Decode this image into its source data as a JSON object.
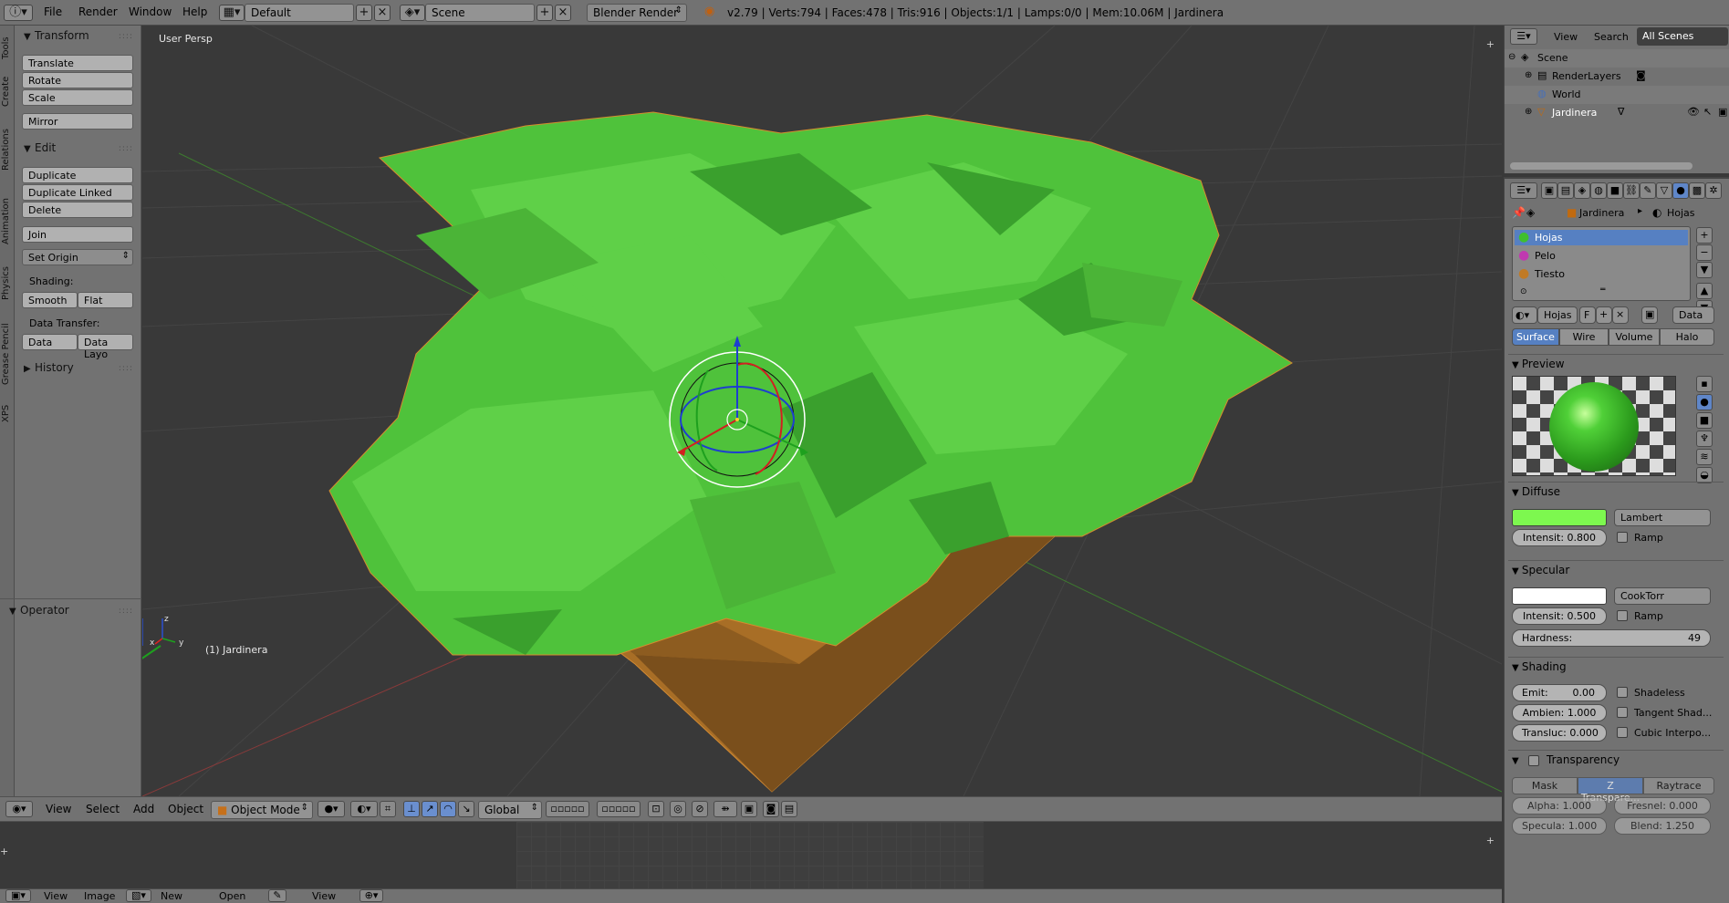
{
  "topbar": {
    "info_icon": "info-icon",
    "menus": [
      "File",
      "Render",
      "Window",
      "Help"
    ],
    "layout": "Default",
    "scene": "Scene",
    "engine": "Blender Render",
    "stats": "v2.79 | Verts:794 | Faces:478 | Tris:916 | Objects:1/1 | Lamps:0/0 | Mem:10.06M | Jardinera"
  },
  "vtabs": [
    "Tools",
    "Create",
    "Relations",
    "Animation",
    "Physics",
    "Grease Pencil",
    "XPS"
  ],
  "toolshelf": {
    "transform": {
      "title": "Transform",
      "buttons": [
        "Translate",
        "Rotate",
        "Scale"
      ],
      "mirror": "Mirror"
    },
    "edit": {
      "title": "Edit",
      "buttons": [
        "Duplicate",
        "Duplicate Linked",
        "Delete"
      ],
      "join": "Join",
      "set_origin": "Set Origin"
    },
    "shading": {
      "label": "Shading:",
      "smooth": "Smooth",
      "flat": "Flat"
    },
    "data_transfer": {
      "label": "Data Transfer:",
      "data": "Data",
      "data_layout": "Data Layo"
    },
    "history": "History",
    "operator": "Operator"
  },
  "viewport": {
    "view_label": "User Persp",
    "object_label": "(1) Jardinera",
    "axis_x": "x",
    "axis_y": "y",
    "axis_z": "z",
    "foliage_color": "#4fc23b",
    "pot_color": "#a86e26",
    "magenta": "#b03cb8"
  },
  "view3d_header": {
    "menus": [
      "View",
      "Select",
      "Add",
      "Object"
    ],
    "mode": "Object Mode",
    "orientation": "Global"
  },
  "bottom_header": {
    "menus": [
      "View",
      "Image"
    ],
    "new": "New",
    "open": "Open",
    "view": "View"
  },
  "outliner": {
    "tabs": [
      "View",
      "Search",
      "All Scenes"
    ],
    "rows": [
      "Scene",
      "RenderLayers",
      "World",
      "Jardinera"
    ]
  },
  "properties": {
    "breadcrumb": [
      "Jardinera",
      "Hojas"
    ],
    "materials": [
      {
        "name": "Hojas",
        "color": "#3fbf2f",
        "selected": true
      },
      {
        "name": "Pelo",
        "color": "#c039b0",
        "selected": false
      },
      {
        "name": "Tiesto",
        "color": "#c07a25",
        "selected": false
      }
    ],
    "material_name": "Hojas",
    "fake_user": "F",
    "data": "Data",
    "type_tabs": [
      "Surface",
      "Wire",
      "Volume",
      "Halo"
    ],
    "preview": "Preview",
    "diffuse": {
      "title": "Diffuse",
      "color": "#7df84f",
      "shader": "Lambert",
      "intensity": "Intensit: 0.800",
      "ramp": "Ramp"
    },
    "specular": {
      "title": "Specular",
      "color": "#ffffff",
      "shader": "CookTorr",
      "intensity": "Intensit: 0.500",
      "ramp": "Ramp",
      "hardness_label": "Hardness:",
      "hardness_value": "49"
    },
    "shading": {
      "title": "Shading",
      "emit": "Emit:",
      "emit_value": "0.00",
      "ambient": "Ambien: 1.000",
      "transluc": "Transluc: 0.000",
      "shadeless": "Shadeless",
      "tangent": "Tangent Shad...",
      "cubic": "Cubic Interpo..."
    },
    "transparency": {
      "title": "Transparency",
      "tabs": [
        "Mask",
        "Z Transpare...",
        "Raytrace"
      ],
      "alpha": "Alpha: 1.000",
      "fresnel": "Fresnel: 0.000",
      "specular": "Specula: 1.000",
      "blend": "Blend: 1.250"
    }
  }
}
